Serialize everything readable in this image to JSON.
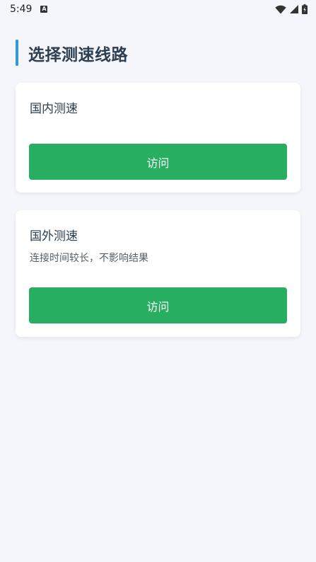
{
  "status_bar": {
    "time": "5:49",
    "notification_icon": "a-icon",
    "icons": [
      "wifi-icon",
      "signal-icon",
      "battery-icon"
    ]
  },
  "page": {
    "title": "选择测速线路",
    "accent_color": "#3498db"
  },
  "cards": [
    {
      "title": "国内测速",
      "description": "",
      "button_label": "访问"
    },
    {
      "title": "国外测速",
      "description": "连接时间较长，不影响结果",
      "button_label": "访问"
    }
  ],
  "colors": {
    "button": "#27ae60",
    "background": "#f4f6fb",
    "card": "#ffffff",
    "title_text": "#2c3e50"
  }
}
